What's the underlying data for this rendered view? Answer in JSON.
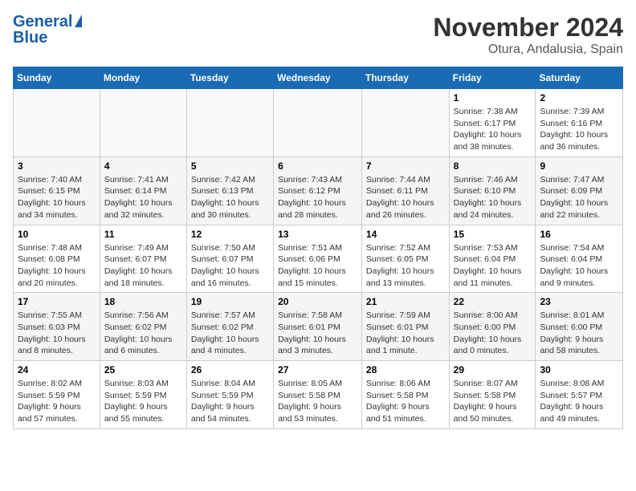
{
  "logo": {
    "line1": "General",
    "line2": "Blue"
  },
  "title": "November 2024",
  "location": "Otura, Andalusia, Spain",
  "days_of_week": [
    "Sunday",
    "Monday",
    "Tuesday",
    "Wednesday",
    "Thursday",
    "Friday",
    "Saturday"
  ],
  "weeks": [
    [
      {
        "num": "",
        "info": ""
      },
      {
        "num": "",
        "info": ""
      },
      {
        "num": "",
        "info": ""
      },
      {
        "num": "",
        "info": ""
      },
      {
        "num": "",
        "info": ""
      },
      {
        "num": "1",
        "info": "Sunrise: 7:38 AM\nSunset: 6:17 PM\nDaylight: 10 hours and 38 minutes."
      },
      {
        "num": "2",
        "info": "Sunrise: 7:39 AM\nSunset: 6:16 PM\nDaylight: 10 hours and 36 minutes."
      }
    ],
    [
      {
        "num": "3",
        "info": "Sunrise: 7:40 AM\nSunset: 6:15 PM\nDaylight: 10 hours and 34 minutes."
      },
      {
        "num": "4",
        "info": "Sunrise: 7:41 AM\nSunset: 6:14 PM\nDaylight: 10 hours and 32 minutes."
      },
      {
        "num": "5",
        "info": "Sunrise: 7:42 AM\nSunset: 6:13 PM\nDaylight: 10 hours and 30 minutes."
      },
      {
        "num": "6",
        "info": "Sunrise: 7:43 AM\nSunset: 6:12 PM\nDaylight: 10 hours and 28 minutes."
      },
      {
        "num": "7",
        "info": "Sunrise: 7:44 AM\nSunset: 6:11 PM\nDaylight: 10 hours and 26 minutes."
      },
      {
        "num": "8",
        "info": "Sunrise: 7:46 AM\nSunset: 6:10 PM\nDaylight: 10 hours and 24 minutes."
      },
      {
        "num": "9",
        "info": "Sunrise: 7:47 AM\nSunset: 6:09 PM\nDaylight: 10 hours and 22 minutes."
      }
    ],
    [
      {
        "num": "10",
        "info": "Sunrise: 7:48 AM\nSunset: 6:08 PM\nDaylight: 10 hours and 20 minutes."
      },
      {
        "num": "11",
        "info": "Sunrise: 7:49 AM\nSunset: 6:07 PM\nDaylight: 10 hours and 18 minutes."
      },
      {
        "num": "12",
        "info": "Sunrise: 7:50 AM\nSunset: 6:07 PM\nDaylight: 10 hours and 16 minutes."
      },
      {
        "num": "13",
        "info": "Sunrise: 7:51 AM\nSunset: 6:06 PM\nDaylight: 10 hours and 15 minutes."
      },
      {
        "num": "14",
        "info": "Sunrise: 7:52 AM\nSunset: 6:05 PM\nDaylight: 10 hours and 13 minutes."
      },
      {
        "num": "15",
        "info": "Sunrise: 7:53 AM\nSunset: 6:04 PM\nDaylight: 10 hours and 11 minutes."
      },
      {
        "num": "16",
        "info": "Sunrise: 7:54 AM\nSunset: 6:04 PM\nDaylight: 10 hours and 9 minutes."
      }
    ],
    [
      {
        "num": "17",
        "info": "Sunrise: 7:55 AM\nSunset: 6:03 PM\nDaylight: 10 hours and 8 minutes."
      },
      {
        "num": "18",
        "info": "Sunrise: 7:56 AM\nSunset: 6:02 PM\nDaylight: 10 hours and 6 minutes."
      },
      {
        "num": "19",
        "info": "Sunrise: 7:57 AM\nSunset: 6:02 PM\nDaylight: 10 hours and 4 minutes."
      },
      {
        "num": "20",
        "info": "Sunrise: 7:58 AM\nSunset: 6:01 PM\nDaylight: 10 hours and 3 minutes."
      },
      {
        "num": "21",
        "info": "Sunrise: 7:59 AM\nSunset: 6:01 PM\nDaylight: 10 hours and 1 minute."
      },
      {
        "num": "22",
        "info": "Sunrise: 8:00 AM\nSunset: 6:00 PM\nDaylight: 10 hours and 0 minutes."
      },
      {
        "num": "23",
        "info": "Sunrise: 8:01 AM\nSunset: 6:00 PM\nDaylight: 9 hours and 58 minutes."
      }
    ],
    [
      {
        "num": "24",
        "info": "Sunrise: 8:02 AM\nSunset: 5:59 PM\nDaylight: 9 hours and 57 minutes."
      },
      {
        "num": "25",
        "info": "Sunrise: 8:03 AM\nSunset: 5:59 PM\nDaylight: 9 hours and 55 minutes."
      },
      {
        "num": "26",
        "info": "Sunrise: 8:04 AM\nSunset: 5:59 PM\nDaylight: 9 hours and 54 minutes."
      },
      {
        "num": "27",
        "info": "Sunrise: 8:05 AM\nSunset: 5:58 PM\nDaylight: 9 hours and 53 minutes."
      },
      {
        "num": "28",
        "info": "Sunrise: 8:06 AM\nSunset: 5:58 PM\nDaylight: 9 hours and 51 minutes."
      },
      {
        "num": "29",
        "info": "Sunrise: 8:07 AM\nSunset: 5:58 PM\nDaylight: 9 hours and 50 minutes."
      },
      {
        "num": "30",
        "info": "Sunrise: 8:08 AM\nSunset: 5:57 PM\nDaylight: 9 hours and 49 minutes."
      }
    ]
  ]
}
